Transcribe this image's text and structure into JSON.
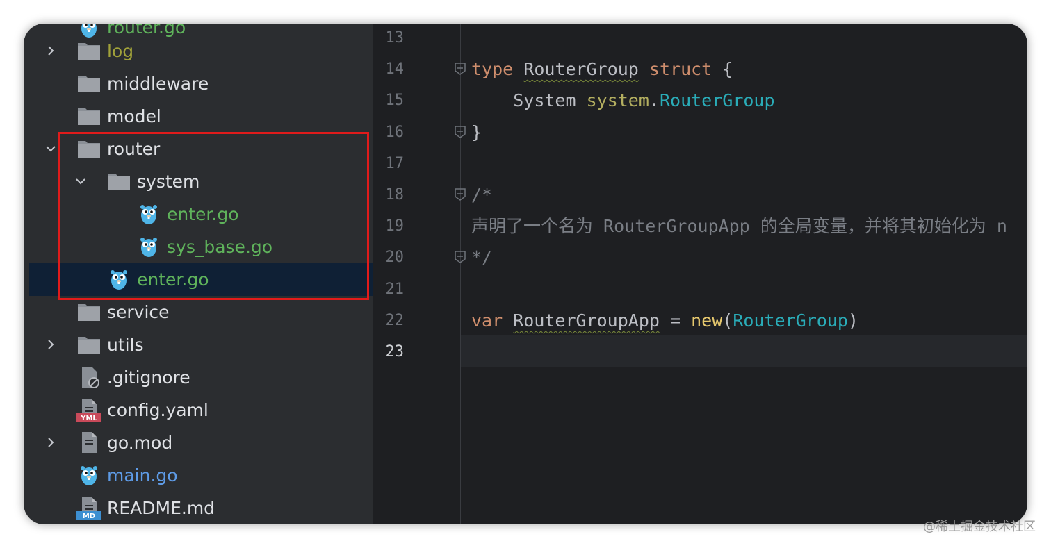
{
  "tree": {
    "items": [
      {
        "label": "router.go",
        "icon": "gopher-icon",
        "kind": "go"
      },
      {
        "label": "log",
        "icon": "folder-icon",
        "kind": "log"
      },
      {
        "label": "middleware",
        "icon": "folder-icon",
        "kind": "dir"
      },
      {
        "label": "model",
        "icon": "folder-icon",
        "kind": "dir"
      },
      {
        "label": "router",
        "icon": "folder-icon",
        "kind": "dir"
      },
      {
        "label": "system",
        "icon": "folder-icon",
        "kind": "dir"
      },
      {
        "label": "enter.go",
        "icon": "gopher-icon",
        "kind": "go"
      },
      {
        "label": "sys_base.go",
        "icon": "gopher-icon",
        "kind": "go"
      },
      {
        "label": "enter.go",
        "icon": "gopher-icon",
        "kind": "go"
      },
      {
        "label": "service",
        "icon": "folder-icon",
        "kind": "dir"
      },
      {
        "label": "utils",
        "icon": "folder-icon",
        "kind": "dir"
      },
      {
        "label": ".gitignore",
        "icon": "ignore-file-icon",
        "kind": "file"
      },
      {
        "label": "config.yaml",
        "icon": "yaml-file-icon",
        "badge": "YML",
        "kind": "file"
      },
      {
        "label": "go.mod",
        "icon": "text-file-icon",
        "kind": "file"
      },
      {
        "label": "main.go",
        "icon": "gopher-icon",
        "kind": "main"
      },
      {
        "label": "README.md",
        "icon": "markdown-file-icon",
        "badge": "MD",
        "kind": "file"
      }
    ]
  },
  "editor": {
    "line_numbers": [
      "13",
      "14",
      "15",
      "16",
      "17",
      "18",
      "19",
      "20",
      "21",
      "22",
      "23"
    ],
    "current_line": "23",
    "code": {
      "l14_type": "type",
      "l14_name": "RouterGroup",
      "l14_struct": "struct",
      "l14_brace": "{",
      "l15_field": "System",
      "l15_pkg": "system",
      "l15_dot": ".",
      "l15_type": "RouterGroup",
      "l16_brace": "}",
      "l18_comment": "/*",
      "l19_comment": "声明了一个名为 RouterGroupApp 的全局变量，并将其初始化为 n",
      "l20_comment": "*/",
      "l22_var": "var",
      "l22_name": "RouterGroupApp",
      "l22_eq": "=",
      "l22_new": "new",
      "l22_paren_open": "(",
      "l22_arg": "RouterGroup",
      "l22_paren_close": ")"
    }
  },
  "watermark": "@稀土掘金技术社区",
  "colors": {
    "highlight_box": "#e01b1b",
    "go_file": "#5fb35b",
    "keyword": "#cf8e6d"
  }
}
